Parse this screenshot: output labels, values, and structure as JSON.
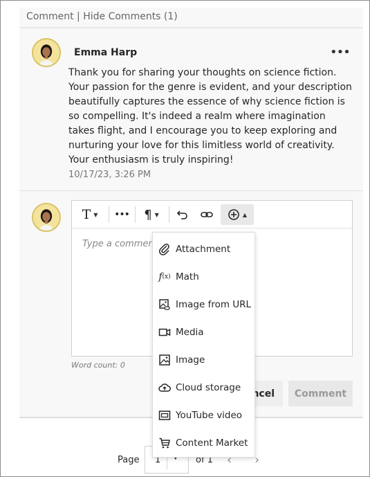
{
  "header": {
    "comment_link": "Comment",
    "separator": "|",
    "hide_link": "Hide Comments (1)"
  },
  "comment": {
    "author": "Emma Harp",
    "more_label": "•••",
    "body": "Thank you for sharing your thoughts on science fiction. Your passion for the genre is evident, and your description beautifully captures the essence of why science fiction is so compelling. It's indeed a realm where imagination takes flight, and I encourage you to keep exploring and nurturing your love for this limitless world of creativity. Your enthusiasm is truly inspiring!",
    "timestamp": "10/17/23, 3:26 PM"
  },
  "editor": {
    "toolbar": {
      "text_style": "T",
      "more": "•••",
      "paragraph": "¶",
      "caret": "▼",
      "caret_up": "▲"
    },
    "placeholder": "Type a comment",
    "word_count": "Word count: 0"
  },
  "buttons": {
    "cancel": "ncel",
    "comment": "Comment"
  },
  "insert_menu": {
    "items": [
      {
        "label": "Attachment",
        "icon": "paperclip-icon"
      },
      {
        "label": "Math",
        "icon": "math-function-icon"
      },
      {
        "label": "Image from URL",
        "icon": "image-link-icon"
      },
      {
        "label": "Media",
        "icon": "video-camera-icon"
      },
      {
        "label": "Image",
        "icon": "image-icon"
      },
      {
        "label": "Cloud storage",
        "icon": "cloud-upload-icon"
      },
      {
        "label": "YouTube video",
        "icon": "youtube-icon"
      },
      {
        "label": "Content Market",
        "icon": "cart-icon"
      }
    ]
  },
  "pagination": {
    "page_label": "Page",
    "current_page": "1",
    "of_label": "of 1",
    "prev": "‹",
    "next": "›",
    "dropdown_arrow": "▼"
  },
  "colors": {
    "panel_bg": "#f8f8f8",
    "avatar_bg": "#f3e39c",
    "text": "#262626",
    "muted": "#777777"
  }
}
